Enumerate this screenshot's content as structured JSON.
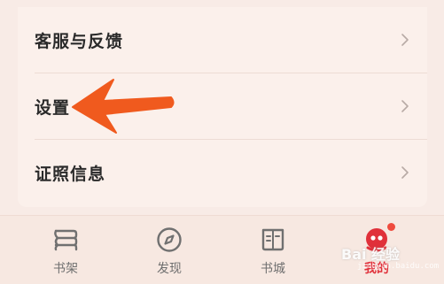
{
  "menu": {
    "items": [
      {
        "label": "客服与反馈",
        "icon": "chevron-right-icon"
      },
      {
        "label": "设置",
        "icon": "chevron-right-icon"
      },
      {
        "label": "证照信息",
        "icon": "chevron-right-icon"
      }
    ]
  },
  "annotation": {
    "icon": "arrow-left-icon",
    "color": "#f05a1e"
  },
  "tabbar": {
    "tabs": [
      {
        "label": "书架",
        "icon": "bookshelf-icon",
        "active": false
      },
      {
        "label": "发现",
        "icon": "compass-icon",
        "active": false
      },
      {
        "label": "书城",
        "icon": "book-store-icon",
        "active": false
      },
      {
        "label": "我的",
        "icon": "profile-avatar-icon",
        "active": true,
        "badge": true
      }
    ]
  },
  "colors": {
    "accent": "#e0303a",
    "badge": "#ef4b3e",
    "background": "#f8ebe6"
  },
  "watermark": {
    "text": "Bai 经验",
    "sub": "jingyan.baidu.com"
  }
}
